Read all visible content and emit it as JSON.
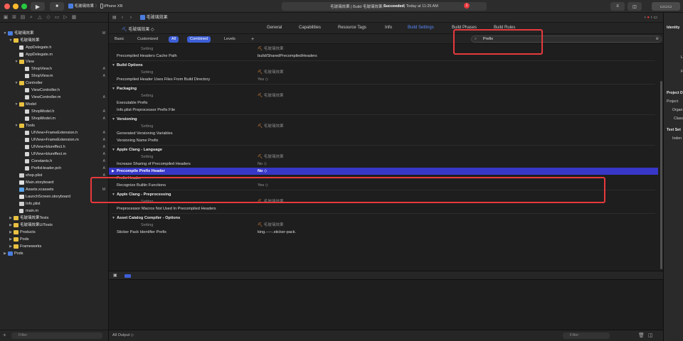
{
  "titlebar": {
    "scheme": "毛玻璃效果",
    "device": "iPhone XR",
    "status_project": "毛玻璃效果 | Build 毛玻璃效果: ",
    "status_result": "Succeeded",
    "status_time": " | Today at 11:25 AM",
    "warning_count": "1"
  },
  "navigator": {
    "items": [
      {
        "label": "毛玻璃效果",
        "depth": 0,
        "kind": "project",
        "badge": "M"
      },
      {
        "label": "毛玻璃效果",
        "depth": 1,
        "kind": "folder",
        "badge": ""
      },
      {
        "label": "AppDelegate.h",
        "depth": 2,
        "kind": "h",
        "badge": ""
      },
      {
        "label": "AppDelegate.m",
        "depth": 2,
        "kind": "m",
        "badge": ""
      },
      {
        "label": "View",
        "depth": 2,
        "kind": "folder",
        "badge": ""
      },
      {
        "label": "ShopView.h",
        "depth": 3,
        "kind": "h",
        "badge": "A"
      },
      {
        "label": "ShopView.m",
        "depth": 3,
        "kind": "m",
        "badge": "A"
      },
      {
        "label": "Controller",
        "depth": 2,
        "kind": "folder",
        "badge": ""
      },
      {
        "label": "ViewController.h",
        "depth": 3,
        "kind": "h",
        "badge": ""
      },
      {
        "label": "ViewController.m",
        "depth": 3,
        "kind": "m",
        "badge": "A"
      },
      {
        "label": "Model",
        "depth": 2,
        "kind": "folder",
        "badge": ""
      },
      {
        "label": "ShopModel.h",
        "depth": 3,
        "kind": "h",
        "badge": "A"
      },
      {
        "label": "ShopModel.m",
        "depth": 3,
        "kind": "m",
        "badge": "A"
      },
      {
        "label": "Tools",
        "depth": 2,
        "kind": "folder",
        "badge": ""
      },
      {
        "label": "UIView+FrameExtension.h",
        "depth": 3,
        "kind": "h",
        "badge": "A"
      },
      {
        "label": "UIView+FrameExtension.m",
        "depth": 3,
        "kind": "m",
        "badge": "A"
      },
      {
        "label": "UIView+blureffect.h",
        "depth": 3,
        "kind": "h",
        "badge": "A"
      },
      {
        "label": "UIView+blureffect.m",
        "depth": 3,
        "kind": "m",
        "badge": "A"
      },
      {
        "label": "Constants.h",
        "depth": 3,
        "kind": "h",
        "badge": "A"
      },
      {
        "label": "PrefixHeader.pch",
        "depth": 3,
        "kind": "h",
        "badge": "A"
      },
      {
        "label": "shop.plist",
        "depth": 2,
        "kind": "plist",
        "badge": "A"
      },
      {
        "label": "Main.storyboard",
        "depth": 2,
        "kind": "sb",
        "badge": ""
      },
      {
        "label": "Assets.xcassets",
        "depth": 2,
        "kind": "assets",
        "badge": "M"
      },
      {
        "label": "LaunchScreen.storyboard",
        "depth": 2,
        "kind": "sb",
        "badge": ""
      },
      {
        "label": "Info.plist",
        "depth": 2,
        "kind": "plist",
        "badge": ""
      },
      {
        "label": "main.m",
        "depth": 2,
        "kind": "m",
        "badge": ""
      },
      {
        "label": "毛玻璃效果Tests",
        "depth": 1,
        "kind": "folder",
        "badge": ""
      },
      {
        "label": "毛玻璃效果UITests",
        "depth": 1,
        "kind": "folder",
        "badge": ""
      },
      {
        "label": "Products",
        "depth": 1,
        "kind": "folder",
        "badge": ""
      },
      {
        "label": "Pods",
        "depth": 1,
        "kind": "folder",
        "badge": ""
      },
      {
        "label": "Frameworks",
        "depth": 1,
        "kind": "folder",
        "badge": ""
      },
      {
        "label": "Pods",
        "depth": 0,
        "kind": "project",
        "badge": ""
      }
    ],
    "filter_placeholder": "Filter"
  },
  "editor": {
    "breadcrumb": "毛玻璃效果",
    "target": "毛玻璃效果",
    "tabs": [
      "General",
      "Capabilities",
      "Resource Tags",
      "Info",
      "Build Settings",
      "Build Phases",
      "Build Rules"
    ],
    "active_tab": "Build Settings",
    "filters": [
      "Basic",
      "Customized",
      "All",
      "Combined",
      "Levels"
    ],
    "search_value": "Prefix"
  },
  "settings": [
    {
      "type": "hdr",
      "setting": "Setting",
      "target": "毛玻璃效果"
    },
    {
      "type": "row",
      "name": "Precompiled Headers Cache Path",
      "value": "build/SharedPrecompiledHeaders"
    },
    {
      "type": "sec",
      "name": "Build Options"
    },
    {
      "type": "hdr",
      "setting": "Setting",
      "target": "毛玻璃效果"
    },
    {
      "type": "row",
      "name": "Precompiled Header Uses Files From Build Directory",
      "value": "Yes ◇"
    },
    {
      "type": "sec",
      "name": "Packaging"
    },
    {
      "type": "hdr",
      "setting": "Setting",
      "target": "毛玻璃效果"
    },
    {
      "type": "row",
      "name": "Executable Prefix",
      "value": ""
    },
    {
      "type": "row",
      "name": "Info.plist Preprocessor Prefix File",
      "value": ""
    },
    {
      "type": "sec",
      "name": "Versioning"
    },
    {
      "type": "hdr",
      "setting": "Setting",
      "target": "毛玻璃效果"
    },
    {
      "type": "row",
      "name": "Generated Versioning Variables",
      "value": ""
    },
    {
      "type": "row",
      "name": "Versioning Name Prefix",
      "value": ""
    },
    {
      "type": "sec",
      "name": "Apple Clang - Language"
    },
    {
      "type": "hdr",
      "setting": "Setting",
      "target": "毛玻璃效果"
    },
    {
      "type": "row",
      "name": "Increase Sharing of Precompiled Headers",
      "value": "No ◇"
    },
    {
      "type": "sel",
      "name": "Precompile Prefix Header",
      "value": "No ◇"
    },
    {
      "type": "row",
      "name": "Prefix Header",
      "value": ""
    },
    {
      "type": "row",
      "name": "Recognize Builtin Functions",
      "value": "Yes ◇"
    },
    {
      "type": "sec",
      "name": "Apple Clang - Preprocessing"
    },
    {
      "type": "hdr",
      "setting": "Setting",
      "target": "毛玻璃效果"
    },
    {
      "type": "row",
      "name": "Preprocessor Macros Not Used In Precompiled Headers",
      "value": ""
    },
    {
      "type": "sec",
      "name": "Asset Catalog Compiler - Options"
    },
    {
      "type": "hdr",
      "setting": "Setting",
      "target": "毛玻璃效果"
    },
    {
      "type": "row",
      "name": "Sticker Pack Identifier Prefix",
      "value": "king.-----.sticker-pack."
    }
  ],
  "console": {
    "output_label": "All Output ◇",
    "filter_placeholder": "Filter"
  },
  "inspector": {
    "labels": [
      "Identity",
      "Lo",
      "F",
      "Project D",
      "Project",
      "Organ",
      "Class",
      "Text Set",
      "Inden"
    ]
  },
  "colors": {
    "accent": "#3d5ed6",
    "selection": "#3737c8",
    "annotation": "#e8393d"
  }
}
